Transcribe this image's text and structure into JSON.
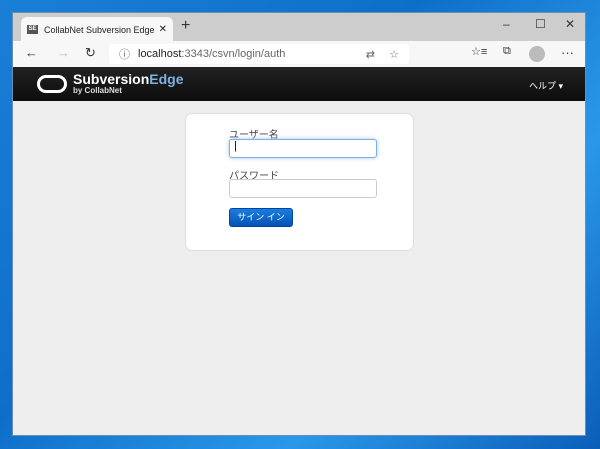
{
  "browser": {
    "tab_title": "CollabNet Subversion Edge ログイン",
    "favicon": "SE",
    "url_host": "localhost",
    "url_path": ":3343/csvn/login/auth",
    "minimize": "–",
    "maximize": "☐",
    "close": "✕"
  },
  "navbar": {
    "brand_main": "Subversion",
    "brand_accent": "Edge",
    "brand_by": "by CollabNet",
    "help": "ヘルプ ▾"
  },
  "login": {
    "username_label": "ユーザー名",
    "username_value": "",
    "password_label": "パスワード",
    "signin": "サイン イン"
  }
}
